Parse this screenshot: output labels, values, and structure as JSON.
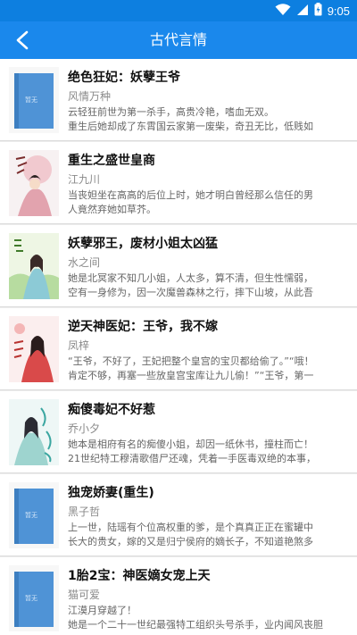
{
  "status_bar": {
    "time": "9:05"
  },
  "app_bar": {
    "title": "古代言情"
  },
  "books": [
    {
      "title": "绝色狂妃：妖孽王爷",
      "author": "风情万种",
      "desc1": "云轻狂前世为第一杀手，高贵冷艳，嗜血无双。",
      "desc2": "重生后她却成了东霄国云家第一废柴，奇丑无比，低贱如",
      "cover": "default",
      "cover_label": "暂无"
    },
    {
      "title": "重生之盛世皇商",
      "author": "江九川",
      "desc1": "当丧妲坐在高高的后位上时，她才明白曾经那么信任的男",
      "desc2": "人竟然弃她如草芥。",
      "cover": "art"
    },
    {
      "title": "妖孽邪王，废材小姐太凶猛",
      "author": "水之间",
      "desc1": "她是北冥家不知几小姐，人太多，算不清，但生性懦弱，",
      "desc2": "空有一身修为，因一次魔兽森林之行，摔下山坡，从此吾",
      "cover": "art"
    },
    {
      "title": "逆天神医妃：王爷，我不嫁",
      "author": "凤梓",
      "desc1": "“王爷，不好了，王妃把整个皇宫的宝贝都给偷了。”“哦！",
      "desc2": "肯定不够，再塞一些放皇宫宝库让九儿偷！”“王爷，第一",
      "cover": "art"
    },
    {
      "title": "痴傻毒妃不好惹",
      "author": "乔小夕",
      "desc1": "她本是相府有名的痴傻小姐，却因一纸休书，撞柱而亡！",
      "desc2": "21世纪特工穆清歌借尸还魂，凭着一手医毒双绝的本事，",
      "cover": "art"
    },
    {
      "title": "独宠娇妻(重生)",
      "author": "黑子哲",
      "desc1": "上一世，陆瑶有个位高权重的爹，是个真真正正在蜜罐中",
      "desc2": "长大的贵女，嫁的又是归宁侯府的嫡长子，不知道艳煞多",
      "cover": "default",
      "cover_label": "暂无"
    },
    {
      "title": "1胎2宝：神医嫡女宠上天",
      "author": "猫可爱",
      "desc1": "江漠月穿越了！",
      "desc2": "她是一个二十一世纪最强特工组织头号杀手，业内闻风丧胆",
      "cover": "default",
      "cover_label": "暂无"
    }
  ]
}
